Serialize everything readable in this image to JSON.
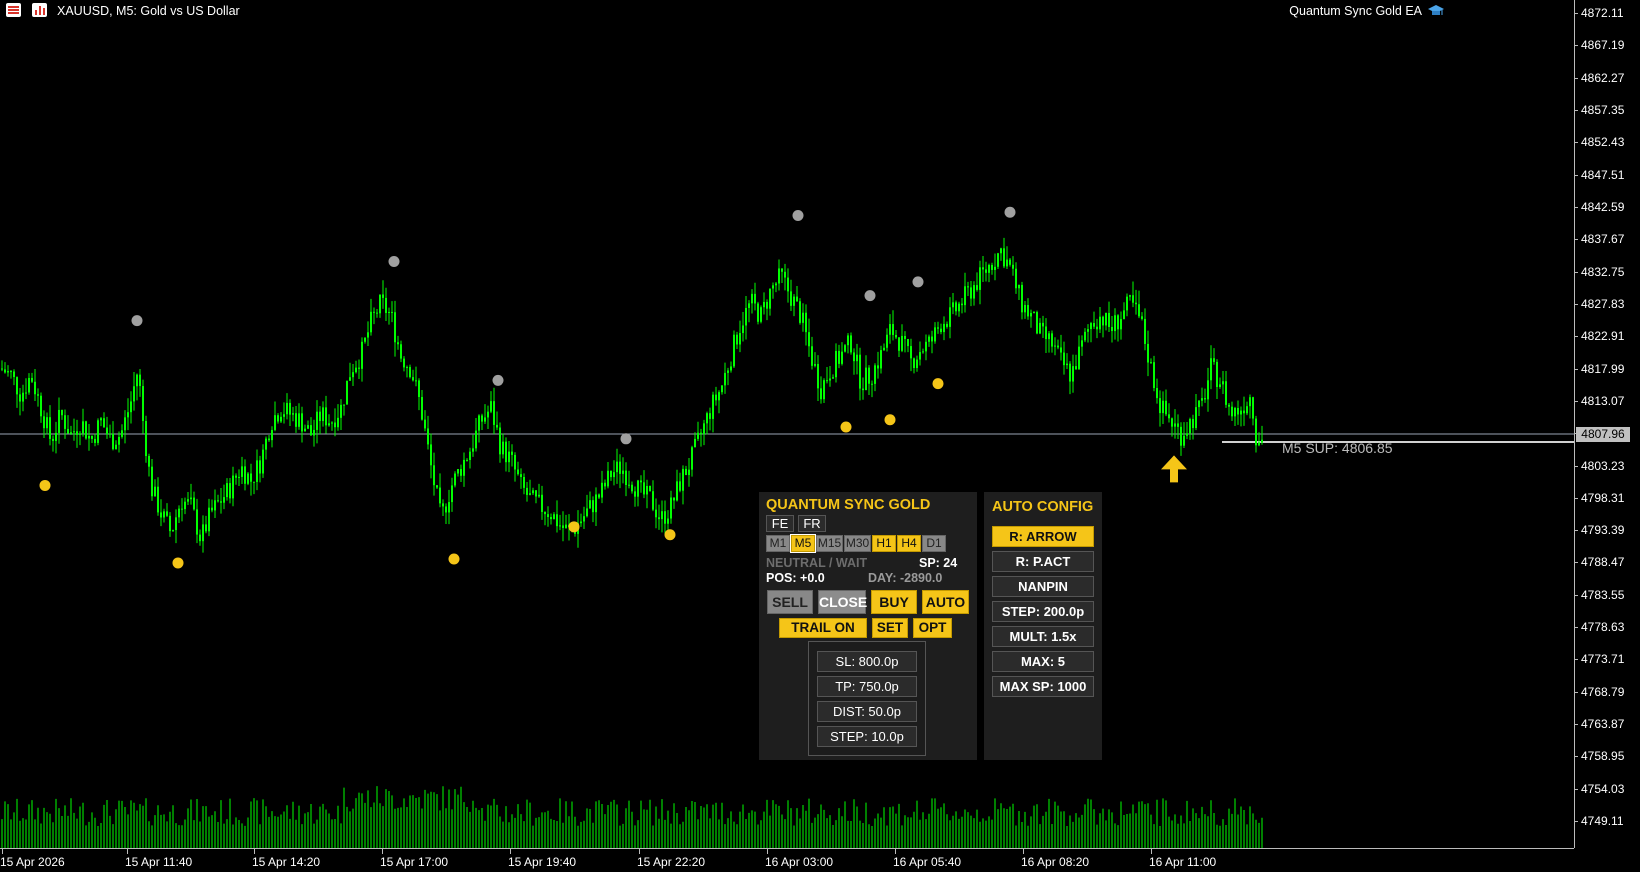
{
  "window": {
    "symbol_title": "XAUUSD, M5:  Gold vs US Dollar",
    "ea_title": "Quantum Sync Gold EA"
  },
  "colors": {
    "background": "#000000",
    "candle": "#00ff00",
    "resistance_dot": "#a0a0a0",
    "support_dot": "#f5c518",
    "accent": "#f5c518",
    "panel_bg": "#1e1e1e"
  },
  "chart_data": {
    "type": "candlestick",
    "symbol": "XAUUSD",
    "timeframe": "M5",
    "ylim": [
      4745.0,
      4873.5
    ],
    "y_ticks": [
      "4872.11",
      "4867.19",
      "4862.27",
      "4857.35",
      "4852.43",
      "4847.51",
      "4842.59",
      "4837.67",
      "4832.75",
      "4827.83",
      "4822.91",
      "4817.99",
      "4813.07",
      "4808.15",
      "4803.23",
      "4798.31",
      "4793.39",
      "4788.47",
      "4783.55",
      "4778.63",
      "4773.71",
      "4768.79",
      "4763.87",
      "4758.95",
      "4754.03",
      "4749.11"
    ],
    "x_ticks": [
      "15 Apr 2026",
      "15 Apr 11:40",
      "15 Apr 14:20",
      "15 Apr 17:00",
      "15 Apr 19:40",
      "15 Apr 22:20",
      "16 Apr 03:00",
      "16 Apr 05:40",
      "16 Apr 08:20",
      "16 Apr 11:00"
    ],
    "current_price": "4807.96",
    "support_label": "M5 SUP: 4806.85",
    "support_level": 4806.85,
    "close_path": [
      [
        0,
        4818
      ],
      [
        10,
        4817
      ],
      [
        20,
        4814
      ],
      [
        30,
        4817
      ],
      [
        40,
        4812
      ],
      [
        50,
        4807
      ],
      [
        60,
        4811
      ],
      [
        70,
        4808
      ],
      [
        80,
        4810
      ],
      [
        90,
        4807
      ],
      [
        100,
        4810
      ],
      [
        110,
        4807
      ],
      [
        120,
        4808
      ],
      [
        130,
        4813
      ],
      [
        137,
        4818
      ],
      [
        142,
        4810
      ],
      [
        150,
        4800
      ],
      [
        160,
        4796
      ],
      [
        170,
        4793
      ],
      [
        180,
        4798
      ],
      [
        190,
        4797
      ],
      [
        200,
        4792
      ],
      [
        210,
        4796
      ],
      [
        220,
        4798
      ],
      [
        230,
        4800
      ],
      [
        240,
        4803
      ],
      [
        250,
        4801
      ],
      [
        260,
        4804
      ],
      [
        270,
        4810
      ],
      [
        280,
        4812
      ],
      [
        290,
        4811
      ],
      [
        300,
        4810
      ],
      [
        310,
        4808
      ],
      [
        320,
        4811
      ],
      [
        330,
        4810
      ],
      [
        340,
        4812
      ],
      [
        350,
        4818
      ],
      [
        360,
        4820
      ],
      [
        370,
        4825
      ],
      [
        380,
        4828
      ],
      [
        390,
        4826
      ],
      [
        400,
        4820
      ],
      [
        410,
        4818
      ],
      [
        420,
        4812
      ],
      [
        430,
        4803
      ],
      [
        440,
        4795
      ],
      [
        450,
        4800
      ],
      [
        460,
        4803
      ],
      [
        470,
        4806
      ],
      [
        480,
        4810
      ],
      [
        490,
        4812
      ],
      [
        500,
        4806
      ],
      [
        510,
        4804
      ],
      [
        520,
        4800
      ],
      [
        530,
        4798
      ],
      [
        540,
        4797
      ],
      [
        550,
        4796
      ],
      [
        560,
        4794
      ],
      [
        570,
        4793
      ],
      [
        580,
        4795
      ],
      [
        590,
        4797
      ],
      [
        600,
        4799
      ],
      [
        610,
        4802
      ],
      [
        620,
        4803
      ],
      [
        630,
        4801
      ],
      [
        640,
        4799
      ],
      [
        650,
        4798
      ],
      [
        660,
        4795
      ],
      [
        670,
        4797
      ],
      [
        680,
        4801
      ],
      [
        690,
        4804
      ],
      [
        700,
        4808
      ],
      [
        710,
        4812
      ],
      [
        720,
        4815
      ],
      [
        730,
        4820
      ],
      [
        740,
        4825
      ],
      [
        750,
        4828
      ],
      [
        760,
        4826
      ],
      [
        770,
        4830
      ],
      [
        780,
        4832
      ],
      [
        790,
        4829
      ],
      [
        800,
        4826
      ],
      [
        810,
        4820
      ],
      [
        820,
        4815
      ],
      [
        830,
        4818
      ],
      [
        840,
        4820
      ],
      [
        850,
        4822
      ],
      [
        860,
        4816
      ],
      [
        870,
        4817
      ],
      [
        880,
        4820
      ],
      [
        890,
        4824
      ],
      [
        900,
        4822
      ],
      [
        910,
        4819
      ],
      [
        920,
        4821
      ],
      [
        930,
        4822
      ],
      [
        940,
        4825
      ],
      [
        950,
        4826
      ],
      [
        960,
        4828
      ],
      [
        970,
        4830
      ],
      [
        980,
        4832
      ],
      [
        990,
        4834
      ],
      [
        1000,
        4836
      ],
      [
        1010,
        4833
      ],
      [
        1020,
        4828
      ],
      [
        1030,
        4826
      ],
      [
        1040,
        4823
      ],
      [
        1050,
        4822
      ],
      [
        1060,
        4819
      ],
      [
        1070,
        4817
      ],
      [
        1080,
        4821
      ],
      [
        1090,
        4825
      ],
      [
        1100,
        4826
      ],
      [
        1110,
        4824
      ],
      [
        1120,
        4826
      ],
      [
        1130,
        4828
      ],
      [
        1140,
        4825
      ],
      [
        1150,
        4818
      ],
      [
        1160,
        4812
      ],
      [
        1170,
        4810
      ],
      [
        1180,
        4808
      ],
      [
        1190,
        4810
      ],
      [
        1200,
        4812
      ],
      [
        1210,
        4818
      ],
      [
        1220,
        4816
      ],
      [
        1230,
        4811
      ],
      [
        1240,
        4812
      ],
      [
        1250,
        4814
      ],
      [
        1255,
        4808
      ],
      [
        1262,
        4807
      ]
    ],
    "resistance_dots": [
      [
        137,
        4825.3
      ],
      [
        394,
        4834.3
      ],
      [
        498,
        4816.2
      ],
      [
        626,
        4807.3
      ],
      [
        798,
        4841.3
      ],
      [
        870,
        4829.1
      ],
      [
        918,
        4831.2
      ],
      [
        1010,
        4841.8
      ]
    ],
    "support_dots": [
      [
        45,
        4800.2
      ],
      [
        178,
        4788.4
      ],
      [
        454,
        4789.0
      ],
      [
        574,
        4793.9
      ],
      [
        670,
        4792.7
      ],
      [
        846,
        4809.1
      ],
      [
        890,
        4810.2
      ],
      [
        938,
        4815.7
      ]
    ],
    "buy_arrow": [
      1174,
      4802.8
    ]
  },
  "panel": {
    "title": "QUANTUM SYNC GOLD",
    "lang_buttons": [
      "FE",
      "FR"
    ],
    "timeframes": [
      {
        "label": "M1",
        "state": "gray"
      },
      {
        "label": "M5",
        "state": "active"
      },
      {
        "label": "M15",
        "state": "gray"
      },
      {
        "label": "M30",
        "state": "gray"
      },
      {
        "label": "H1",
        "state": "yellow"
      },
      {
        "label": "H4",
        "state": "yellow"
      },
      {
        "label": "D1",
        "state": "gray"
      }
    ],
    "status": "NEUTRAL / WAIT",
    "spread": "SP: 24",
    "pos": "POS: +0.0",
    "day": "DAY: -2890.0",
    "sell": "SELL",
    "close": "CLOSE",
    "buy": "BUY",
    "auto": "AUTO",
    "trail": "TRAIL ON",
    "set": "SET",
    "opt": "OPT",
    "params": [
      "SL: 800.0p",
      "TP: 750.0p",
      "DIST: 50.0p",
      "STEP: 10.0p"
    ]
  },
  "auto_config": {
    "title": "AUTO CONFIG",
    "items": [
      {
        "label": "R: ARROW",
        "active": true
      },
      {
        "label": "R: P.ACT",
        "active": false
      },
      {
        "label": "NANPIN",
        "active": false
      },
      {
        "label": "STEP: 200.0p",
        "active": false
      },
      {
        "label": "MULT: 1.5x",
        "active": false
      },
      {
        "label": "MAX: 5",
        "active": false
      },
      {
        "label": "MAX SP: 1000",
        "active": false
      }
    ]
  }
}
